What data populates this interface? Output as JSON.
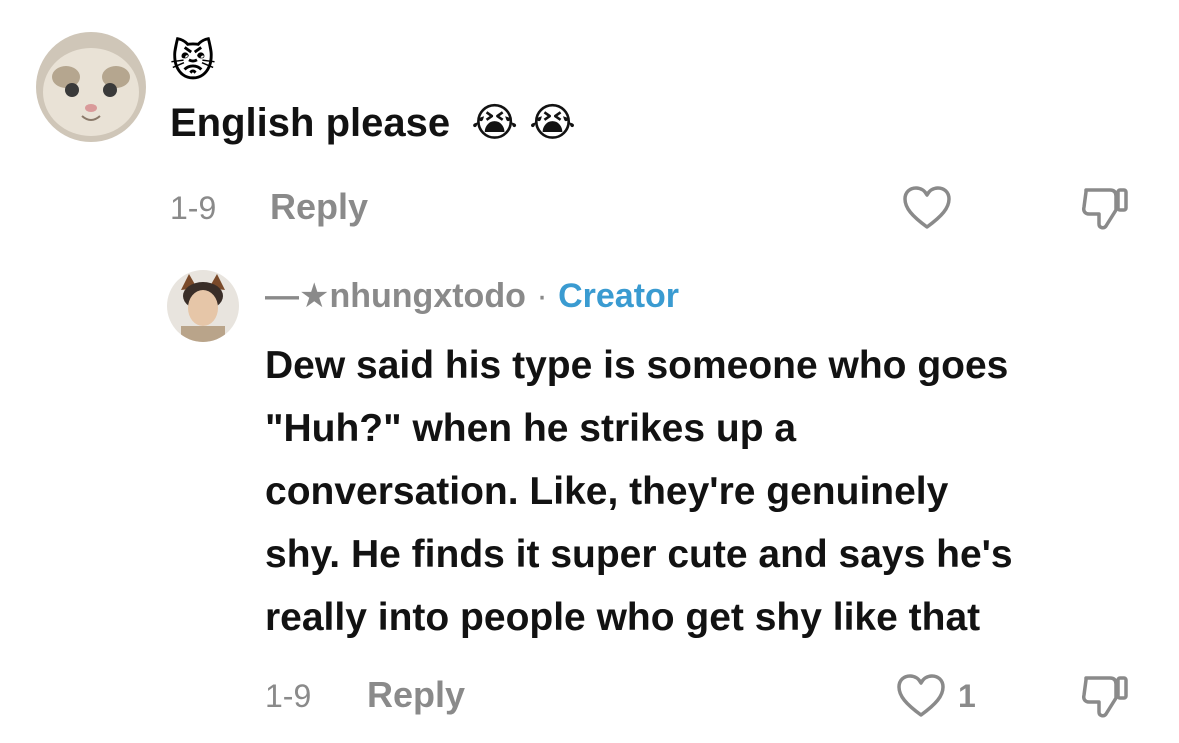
{
  "comment1": {
    "username_emoji": "😾",
    "text": "English please",
    "emojis": "😭 😭",
    "date": "1-9",
    "reply_label": "Reply"
  },
  "comment2": {
    "username": "—★nhungxtodo",
    "separator": "·",
    "creator_badge": "Creator",
    "lines": [
      "Dew said his type is someone who goes",
      "\"Huh?\" when he strikes up a",
      "conversation. Like, they're genuinely",
      "shy. He finds it super cute and says he's",
      "really into people who get shy like that"
    ],
    "date": "1-9",
    "reply_label": "Reply",
    "like_count": "1"
  },
  "icons": {
    "like": "heart-outline-icon",
    "dislike": "thumbs-down-outline-icon"
  },
  "colors": {
    "text": "#121212",
    "muted": "#8a8a8a",
    "creator": "#3a9bd1"
  }
}
